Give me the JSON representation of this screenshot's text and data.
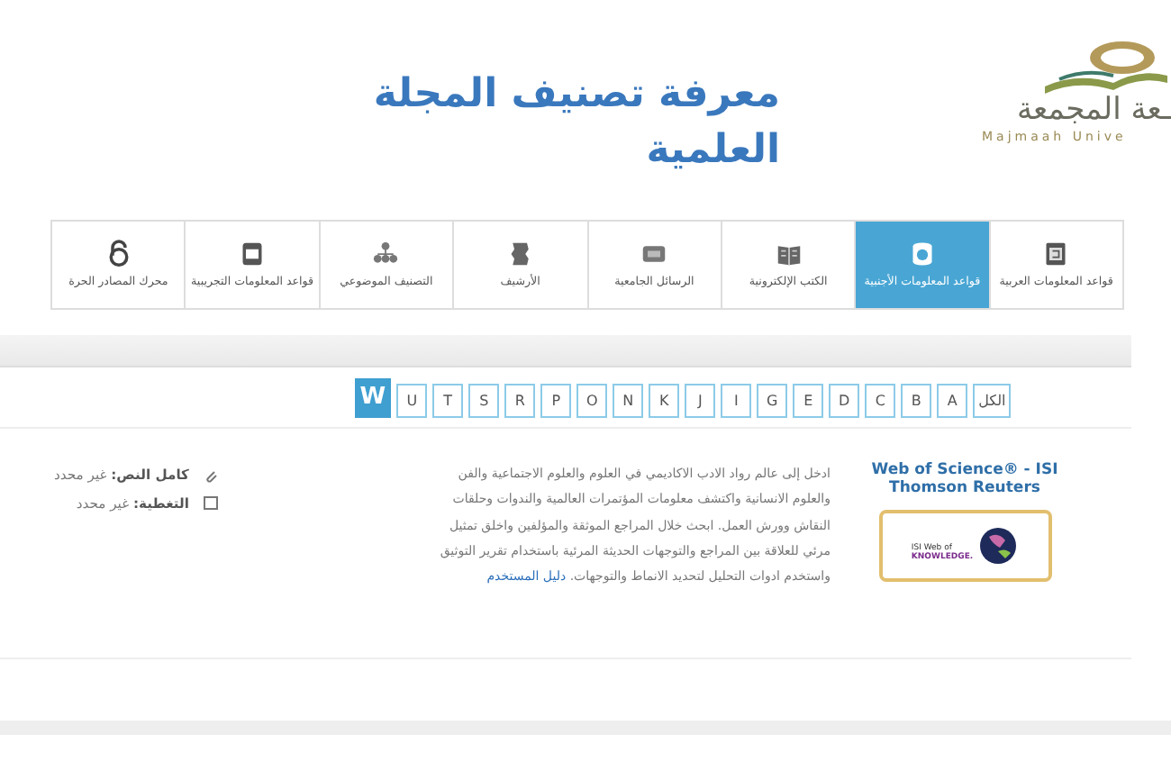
{
  "header": {
    "logo_text": "ـعة المجمعة",
    "logo_subtext": "Majmaah Unive",
    "title_lines": [
      "معرفة تصنيف المجلة",
      "العلمية"
    ]
  },
  "tabs": [
    {
      "label": "قواعد المعلومات العربية",
      "selected": false
    },
    {
      "label": "قواعد المعلومات الأجنبية",
      "selected": true
    },
    {
      "label": "الكتب الإلكترونية",
      "selected": false
    },
    {
      "label": "الرسائل الجامعية",
      "selected": false
    },
    {
      "label": "الأرشيف",
      "selected": false
    },
    {
      "label": "التصنيف الموضوعي",
      "selected": false
    },
    {
      "label": "قواعد المعلومات التجريبية",
      "selected": false
    },
    {
      "label": "محرك المصادر الحرة",
      "selected": false
    }
  ],
  "letters": [
    {
      "label": "الكل",
      "selected": false
    },
    {
      "label": "A",
      "selected": false
    },
    {
      "label": "B",
      "selected": false
    },
    {
      "label": "C",
      "selected": false
    },
    {
      "label": "D",
      "selected": false
    },
    {
      "label": "E",
      "selected": false
    },
    {
      "label": "G",
      "selected": false
    },
    {
      "label": "I",
      "selected": false
    },
    {
      "label": "J",
      "selected": false
    },
    {
      "label": "K",
      "selected": false
    },
    {
      "label": "N",
      "selected": false
    },
    {
      "label": "O",
      "selected": false
    },
    {
      "label": "P",
      "selected": false
    },
    {
      "label": "R",
      "selected": false
    },
    {
      "label": "S",
      "selected": false
    },
    {
      "label": "T",
      "selected": false
    },
    {
      "label": "U",
      "selected": false
    },
    {
      "label": "W",
      "selected": true
    }
  ],
  "resource": {
    "title": "Web of Science® - ISI Thomson Reuters",
    "logo_lines": [
      "ISI Web of",
      "KNOWLEDGE."
    ],
    "description": "ادخل إلى عالم رواد الادب الاكاديمي في العلوم والعلوم الاجتماعية والفن والعلوم الانسانية واكتشف معلومات المؤتمرات العالمية والندوات وحلقات النقاش وورش العمل. ابحث خلال المراجع الموثقة والمؤلفين واخلق تمثيل مرئي للعلاقة بين المراجع والتوجهات الحديثة المرئية باستخدام تقرير التوثيق واستخدم ادوات التحليل لتحديد الانماط والتوجهات.",
    "link": "دليل المستخدم",
    "meta": [
      "**كامل النص:** غير محدد",
      "**التغطية:** غير محدد"
    ]
  }
}
